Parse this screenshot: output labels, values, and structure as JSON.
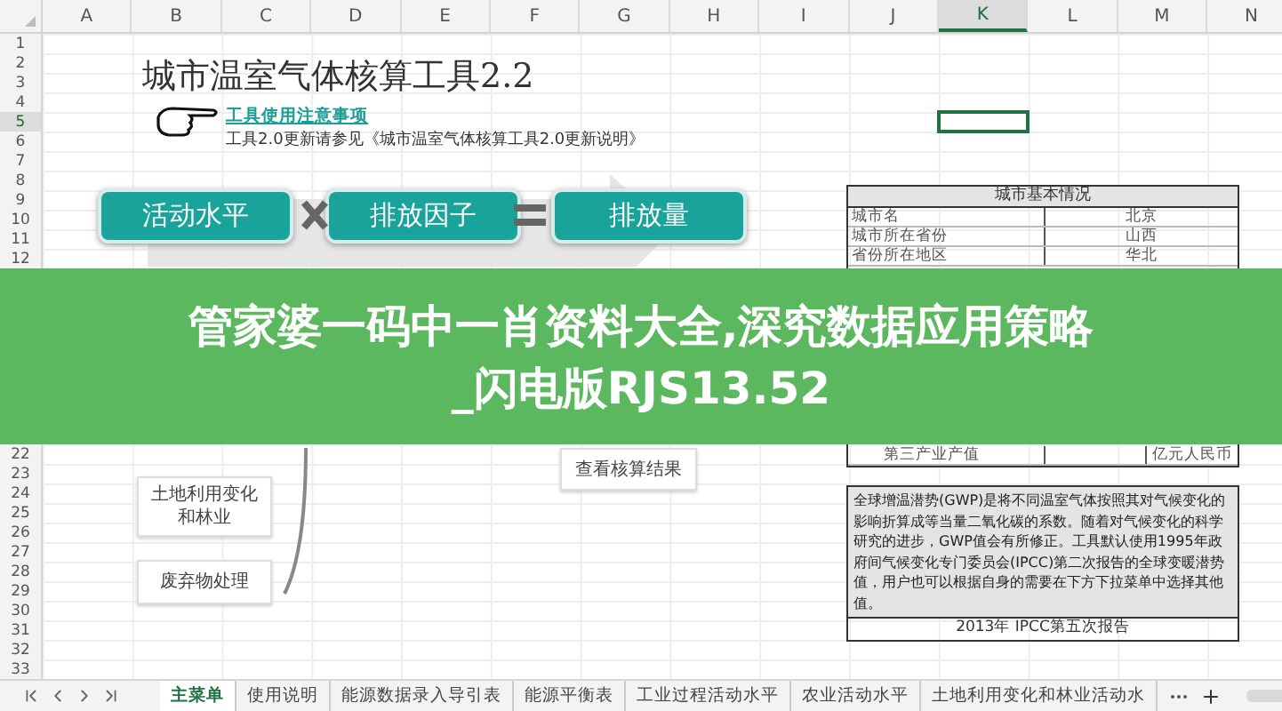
{
  "columns": [
    {
      "label": "A",
      "selected": false
    },
    {
      "label": "B",
      "selected": false
    },
    {
      "label": "C",
      "selected": false
    },
    {
      "label": "D",
      "selected": false
    },
    {
      "label": "E",
      "selected": false
    },
    {
      "label": "F",
      "selected": false
    },
    {
      "label": "G",
      "selected": false
    },
    {
      "label": "H",
      "selected": false
    },
    {
      "label": "I",
      "selected": false
    },
    {
      "label": "J",
      "selected": false
    },
    {
      "label": "K",
      "selected": true
    },
    {
      "label": "L",
      "selected": false
    },
    {
      "label": "M",
      "selected": false
    },
    {
      "label": "N",
      "selected": false
    }
  ],
  "rows_above": [
    {
      "label": "1",
      "selected": false
    },
    {
      "label": "2",
      "selected": false
    },
    {
      "label": "3",
      "selected": false
    },
    {
      "label": "4",
      "selected": false
    },
    {
      "label": "5",
      "selected": true
    },
    {
      "label": "6",
      "selected": false
    },
    {
      "label": "7",
      "selected": false
    },
    {
      "label": "8",
      "selected": false
    },
    {
      "label": "9",
      "selected": false
    },
    {
      "label": "10",
      "selected": false
    },
    {
      "label": "11",
      "selected": false
    },
    {
      "label": "12",
      "selected": false
    }
  ],
  "rows_below": [
    {
      "label": "22",
      "selected": false
    },
    {
      "label": "23",
      "selected": false
    },
    {
      "label": "24",
      "selected": false
    },
    {
      "label": "25",
      "selected": false
    },
    {
      "label": "26",
      "selected": false
    },
    {
      "label": "27",
      "selected": false
    },
    {
      "label": "28",
      "selected": false
    },
    {
      "label": "29",
      "selected": false
    },
    {
      "label": "30",
      "selected": false
    },
    {
      "label": "31",
      "selected": false
    },
    {
      "label": "32",
      "selected": false
    },
    {
      "label": "33",
      "selected": false
    }
  ],
  "title": "城市温室气体核算工具2.2",
  "notice": {
    "link": "工具使用注意事项",
    "text": "工具2.0更新请参见《城市温室气体核算工具2.0更新说明》"
  },
  "formula": {
    "terms": [
      "活动水平",
      "排放因子",
      "排放量"
    ]
  },
  "flow": {
    "sources": [
      "土地利用变化和林业",
      "废弃物处理"
    ],
    "result": "查看核算结果"
  },
  "city_table": {
    "title": "城市基本情况",
    "rows_top": [
      {
        "label": "城市名",
        "value": "北京"
      },
      {
        "label": "城市所在省份",
        "value": "山西"
      },
      {
        "label": "省份所在地区",
        "value": "华北"
      }
    ],
    "rows_bottom": [
      {
        "label": "第三产业产值",
        "unit": "亿元人民币"
      }
    ]
  },
  "gwp_note": {
    "text": "全球增温潜势(GWP)是将不同温室气体按照其对气候变化的影响折算成等当量二氧化碳的系数。随着对气候变化的科学研究的进步，GWP值会有所修正。工具默认使用1995年政府间气候变化专门委员会(IPCC)第二次报告的全球变暖潜势值，用户也可以根据自身的需要在下方下拉菜单中选择其他值。",
    "source": "2013年 IPCC第五次报告"
  },
  "banner": {
    "lines": [
      "管家婆一码中一肖资料大全,深究数据应用策略",
      "_闪电版RJS13.52"
    ]
  },
  "sheet_tabs": [
    {
      "label": "主菜单",
      "selected": true
    },
    {
      "label": "使用说明",
      "selected": false
    },
    {
      "label": "能源数据录入导引表",
      "selected": false
    },
    {
      "label": "能源平衡表",
      "selected": false
    },
    {
      "label": "工业过程活动水平",
      "selected": false
    },
    {
      "label": "农业活动水平",
      "selected": false
    },
    {
      "label": "土地利用变化和林业活动水",
      "selected": false
    }
  ]
}
